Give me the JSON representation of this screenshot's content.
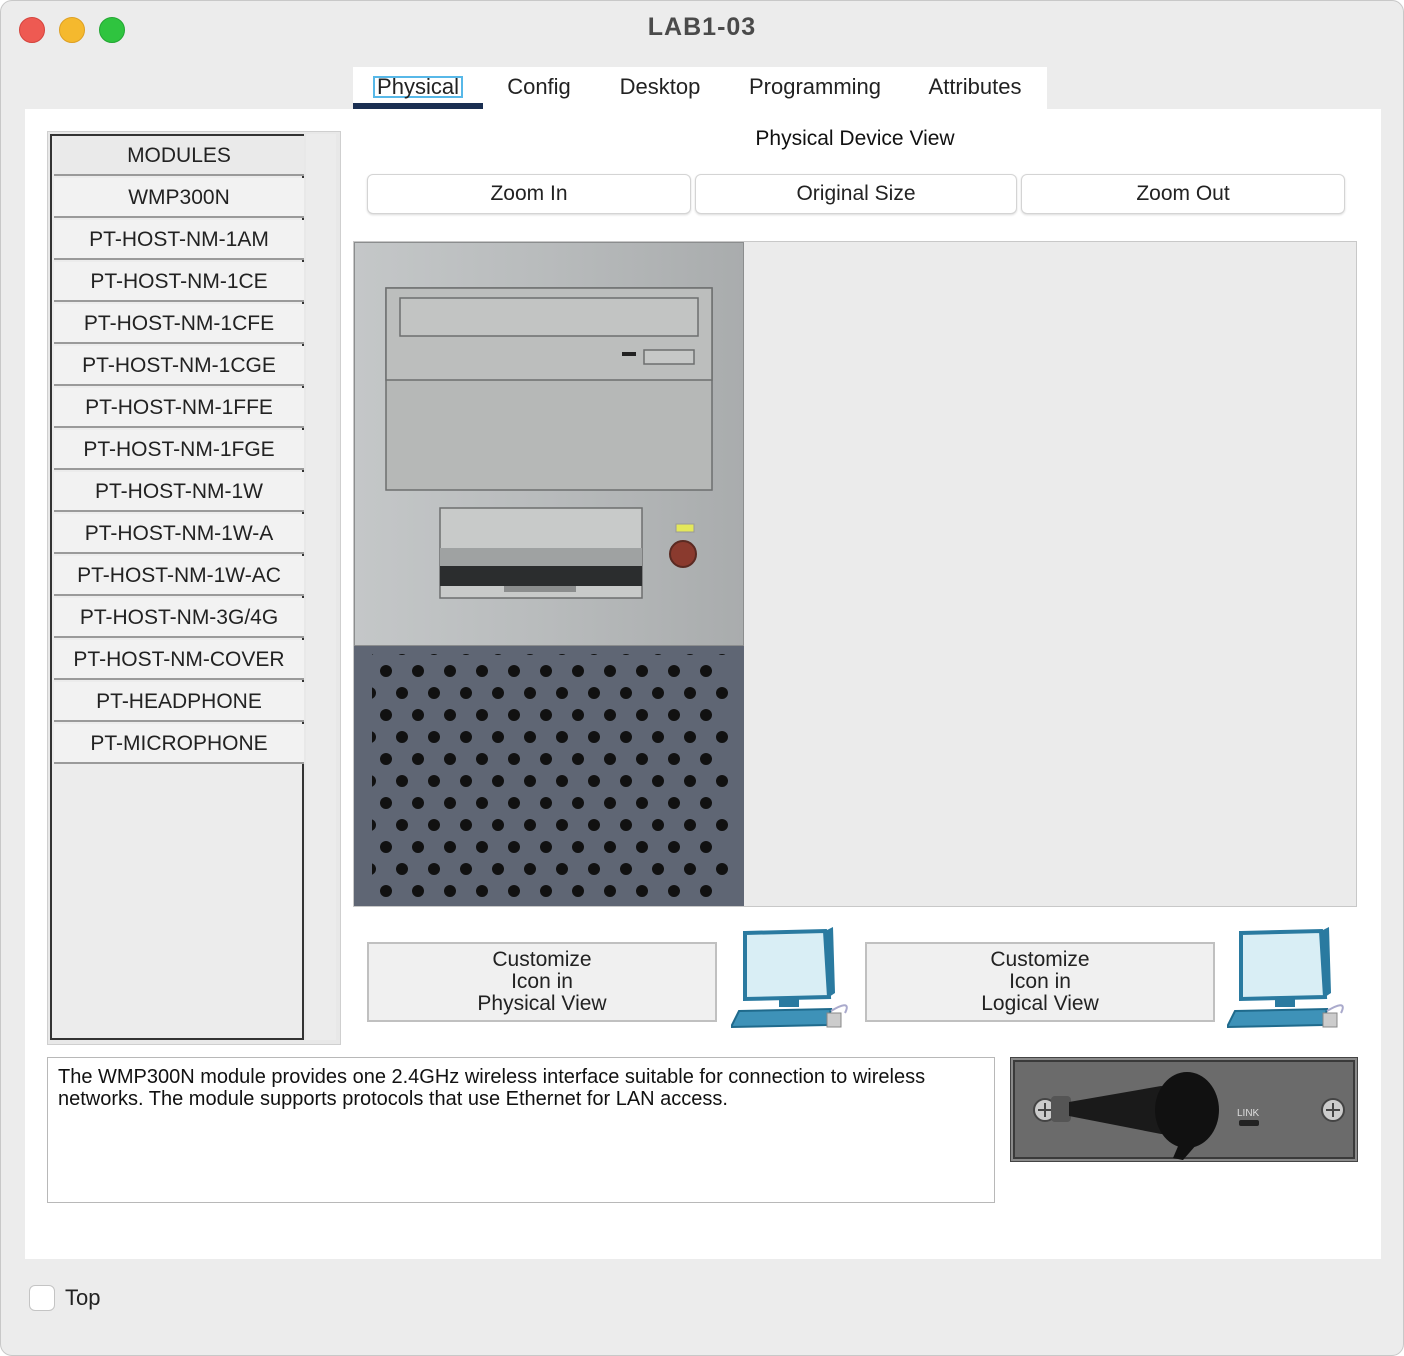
{
  "window": {
    "title": "LAB1-03"
  },
  "tabs": [
    {
      "label": "Physical",
      "active": true
    },
    {
      "label": "Config"
    },
    {
      "label": "Desktop"
    },
    {
      "label": "Programming"
    },
    {
      "label": "Attributes"
    }
  ],
  "modules": {
    "header": "MODULES",
    "items": [
      "WMP300N",
      "PT-HOST-NM-1AM",
      "PT-HOST-NM-1CE",
      "PT-HOST-NM-1CFE",
      "PT-HOST-NM-1CGE",
      "PT-HOST-NM-1FFE",
      "PT-HOST-NM-1FGE",
      "PT-HOST-NM-1W",
      "PT-HOST-NM-1W-A",
      "PT-HOST-NM-1W-AC",
      "PT-HOST-NM-3G/4G",
      "PT-HOST-NM-COVER",
      "PT-HEADPHONE",
      "PT-MICROPHONE"
    ]
  },
  "physical_view": {
    "title": "Physical Device View",
    "zoom_in": "Zoom In",
    "original_size": "Original Size",
    "zoom_out": "Zoom Out"
  },
  "customize": {
    "physical": [
      "Customize",
      "Icon in",
      "Physical View"
    ],
    "logical": [
      "Customize",
      "Icon in",
      "Logical View"
    ]
  },
  "description": "The WMP300N module provides one 2.4GHz wireless interface suitable for connection to wireless networks. The module supports protocols that use Ethernet for LAN access.",
  "module_image": {
    "label": "LINK"
  },
  "footer": {
    "top_label": "Top",
    "top_checked": false
  },
  "icons": {
    "pc": "pc-icon",
    "antenna": "wireless-module-icon"
  }
}
